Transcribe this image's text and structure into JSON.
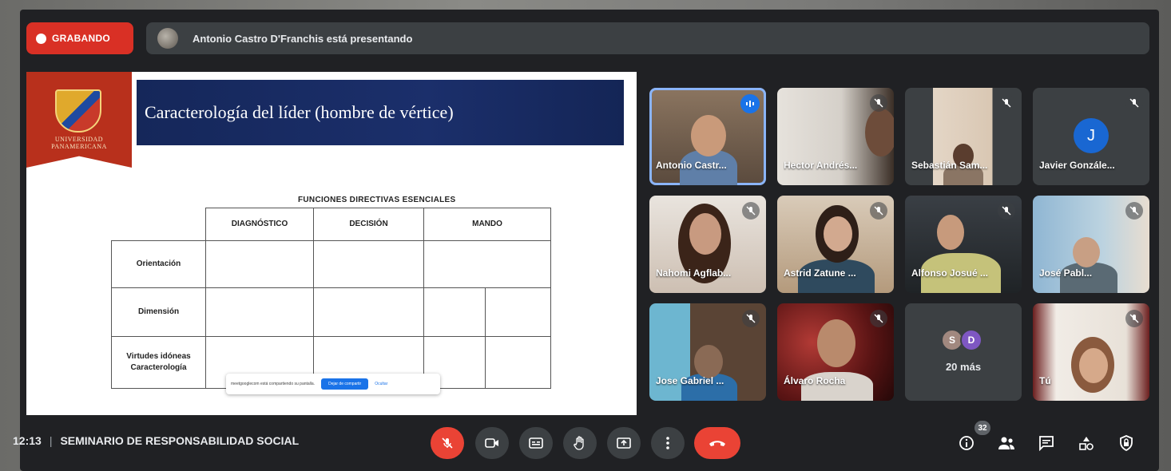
{
  "recording": {
    "label": "GRABANDO"
  },
  "presenting": {
    "text": "Antonio Castro D'Franchis está presentando"
  },
  "slide": {
    "logo_text": "UNIVERSIDAD PANAMERICANA",
    "title": "Caracterología del líder (hombre de vértice)",
    "table_title": "FUNCIONES DIRECTIVAS ESENCIALES",
    "columns": [
      "DIAGNÓSTICO",
      "DECISIÓN",
      "MANDO"
    ],
    "rows": [
      "Orientación",
      "Dimensión",
      "Virtudes idóneas Caracterología"
    ],
    "share_popup": {
      "message": "meetgooglecom está compartiendo su pantalla.",
      "stop_label": "Dejar de compartir",
      "hide_label": "Ocultar"
    }
  },
  "participants": [
    {
      "name": "Antonio Castr...",
      "state": "speaking"
    },
    {
      "name": "Hector Andrés...",
      "state": "muted"
    },
    {
      "name": "Sebastián Sam...",
      "state": "muted"
    },
    {
      "name": "Javier Gonzále...",
      "state": "muted",
      "initial": "J"
    },
    {
      "name": "Nahomi Agflab...",
      "state": "muted"
    },
    {
      "name": "Astrid Zatune ...",
      "state": "muted"
    },
    {
      "name": "Alfonso Josué ...",
      "state": "muted"
    },
    {
      "name": "José Pabl...",
      "state": "muted"
    },
    {
      "name": "Jose Gabriel ...",
      "state": "muted"
    },
    {
      "name": "Álvaro Rocha",
      "state": "muted"
    },
    {
      "name": "Tú",
      "state": "muted"
    }
  ],
  "more": {
    "label": "20 más",
    "avatars": [
      "S",
      "D"
    ]
  },
  "bottom": {
    "time": "12:13",
    "meeting_name": "SEMINARIO DE RESPONSABILIDAD SOCIAL",
    "people_count": "32"
  },
  "colors": {
    "record": "#d93025",
    "accent": "#1a73e8",
    "hangup": "#ea4335"
  }
}
